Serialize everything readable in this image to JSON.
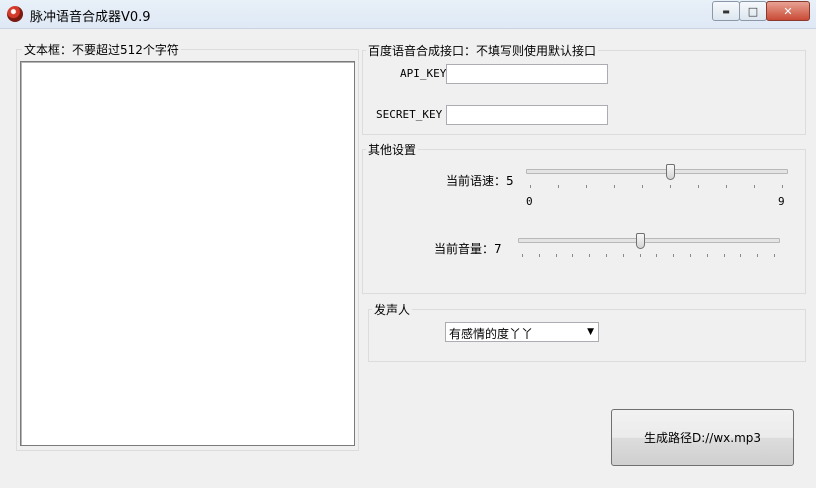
{
  "window": {
    "title": "脉冲语音合成器V0.9",
    "min_symbol": "▬",
    "max_symbol": "□",
    "close_symbol": "✕"
  },
  "text_box": {
    "label": "文本框：不要超过512个字符",
    "value": ""
  },
  "api": {
    "group_label": "百度语音合成接口：不填写则使用默认接口",
    "api_key_label": "API_KEY",
    "api_key_value": "",
    "secret_key_label": "SECRET_KEY",
    "secret_key_value": ""
  },
  "settings": {
    "group_label": "其他设置",
    "speed_label": "当前语速：5",
    "speed": {
      "value": 5,
      "min": 0,
      "max": 9,
      "min_label": "0",
      "max_label": "9"
    },
    "volume_label": "当前音量：7",
    "volume": {
      "value": 7,
      "min": 0,
      "max": 15
    }
  },
  "speaker": {
    "group_label": "发声人",
    "selected": "有感情的度丫丫"
  },
  "generate_button": {
    "label": "生成路径D://wx.mp3"
  }
}
